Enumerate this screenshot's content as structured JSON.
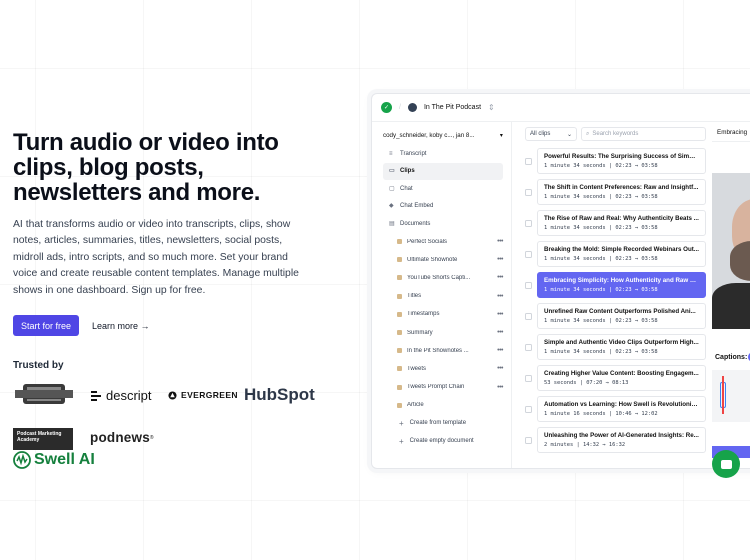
{
  "hero": {
    "headline": "Turn audio or video into clips, blog posts, newsletters and more.",
    "description": "AI that transforms audio or video into transcripts, clips, show notes, articles, summaries, titles, newsletters, social posts, midroll ads, intro scripts, and so much more. Set your brand voice and create reusable content templates. Manage multiple shows in one dashboard. Sign up for free.",
    "cta_primary": "Start for free",
    "cta_secondary": "Learn more →"
  },
  "trusted": {
    "heading": "Trusted by",
    "logos": [
      {
        "name": "School of Podcasting"
      },
      {
        "name": "descript"
      },
      {
        "name": "EVERGREEN"
      },
      {
        "name": "HubSpot",
        "text": "HubSpot"
      },
      {
        "name": "Podcast Marketing Academy"
      },
      {
        "name": "podnews",
        "text": "podnews",
        "mark": "®"
      },
      {
        "name": "Swell AI",
        "text": "Swell AI"
      }
    ]
  },
  "app": {
    "podcast_name": "In The Pit Podcast",
    "account": "cody_schneider, koby c..., jan 8...",
    "nav": [
      {
        "label": "Transcript",
        "icon": "transcript-icon"
      },
      {
        "label": "Clips",
        "icon": "clips-icon",
        "active": true
      },
      {
        "label": "Chat",
        "icon": "chat-icon"
      },
      {
        "label": "Chat Embed",
        "icon": "chat-embed-icon"
      },
      {
        "label": "Documents",
        "icon": "documents-icon"
      }
    ],
    "documents": [
      "Perfect Socials",
      "Ultimate Shownote",
      "YouTube Shorts Capti...",
      "Titles",
      "Timestamps",
      "Summary",
      "In the Pit Shownotes ...",
      "Tweets",
      "Tweets Prompt Chain",
      "Article"
    ],
    "create_template": "Create from template",
    "create_empty": "Create empty document",
    "filter": {
      "selected": "All clips",
      "search_placeholder": "Search keywords"
    },
    "clips": [
      {
        "title": "Powerful Results: The Surprising Success of Simpl...",
        "meta": "1 minute 34 seconds | 02:23 → 03:58"
      },
      {
        "title": "The Shift in Content Preferences: Raw and Insightf...",
        "meta": "1 minute 34 seconds | 02:23 → 03:58"
      },
      {
        "title": "The Rise of Raw and Real: Why Authenticity Beats ...",
        "meta": "1 minute 34 seconds | 02:23 → 03:58"
      },
      {
        "title": "Breaking the Mold: Simple Recorded Webinars Out...",
        "meta": "1 minute 34 seconds | 02:23 → 03:58"
      },
      {
        "title": "Embracing Simplicity: How Authenticity and Raw C...",
        "meta": "1 minute 34 seconds | 02:23 → 03:58",
        "active": true
      },
      {
        "title": "Unrefined Raw Content Outperforms Polished Ani...",
        "meta": "1 minute 34 seconds | 02:23 → 03:58"
      },
      {
        "title": "Simple and Authentic Video Clips Outperform High...",
        "meta": "1 minute 34 seconds | 02:23 → 03:58"
      },
      {
        "title": "Creating Higher Value Content: Boosting Engagem...",
        "meta": "53 seconds | 07:20 → 08:13"
      },
      {
        "title": "Automation vs Learning: How Swell is Revolutionizi...",
        "meta": "1 minute 16 seconds | 10:46 → 12:02"
      },
      {
        "title": "Unleashing the Power of AI-Generated Insights: Re...",
        "meta": "2 minutes | 14:32 → 16:32"
      }
    ],
    "preview": {
      "title": "Embracing",
      "captions_label": "Captions:"
    }
  }
}
